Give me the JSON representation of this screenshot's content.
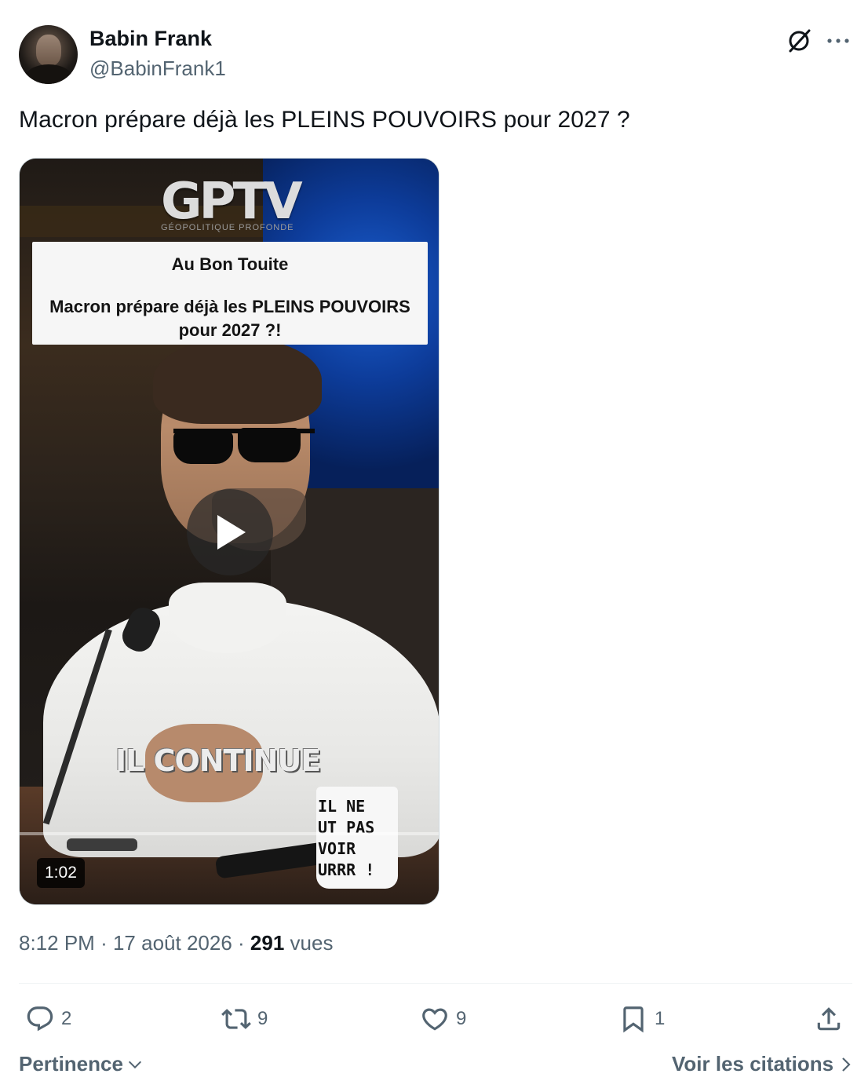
{
  "author": {
    "display_name": "Babin Frank",
    "handle": "@BabinFrank1"
  },
  "header_icons": [
    "grok-icon",
    "more-icon"
  ],
  "tweet": {
    "text": "Macron prépare déjà les PLEINS POUVOIRS pour 2027 ?"
  },
  "video": {
    "logo": "GPTV",
    "logo_subtitle": "GÉOPOLITIQUE PROFONDE",
    "card_title": "Au Bon Touite",
    "card_body": "Macron prépare déjà les PLEINS POUVOIRS pour 2027 ?!",
    "caption": "IL CONTINUE",
    "mug_text": "IL NE\nUT PAS\nVOIR\nURRR !",
    "duration": "1:02",
    "progress": 0
  },
  "meta": {
    "time": "8:12 PM",
    "date": "17 août 2026",
    "separator": "·",
    "views_count": "291",
    "views_label": "vues"
  },
  "actions": {
    "replies": "2",
    "retweets": "9",
    "likes": "9",
    "bookmarks": "1"
  },
  "footer": {
    "sort_label": "Pertinence",
    "quotes_label": "Voir les citations"
  },
  "colors": {
    "text_primary": "#0f1419",
    "text_secondary": "#536471",
    "border": "#cfd9de"
  }
}
